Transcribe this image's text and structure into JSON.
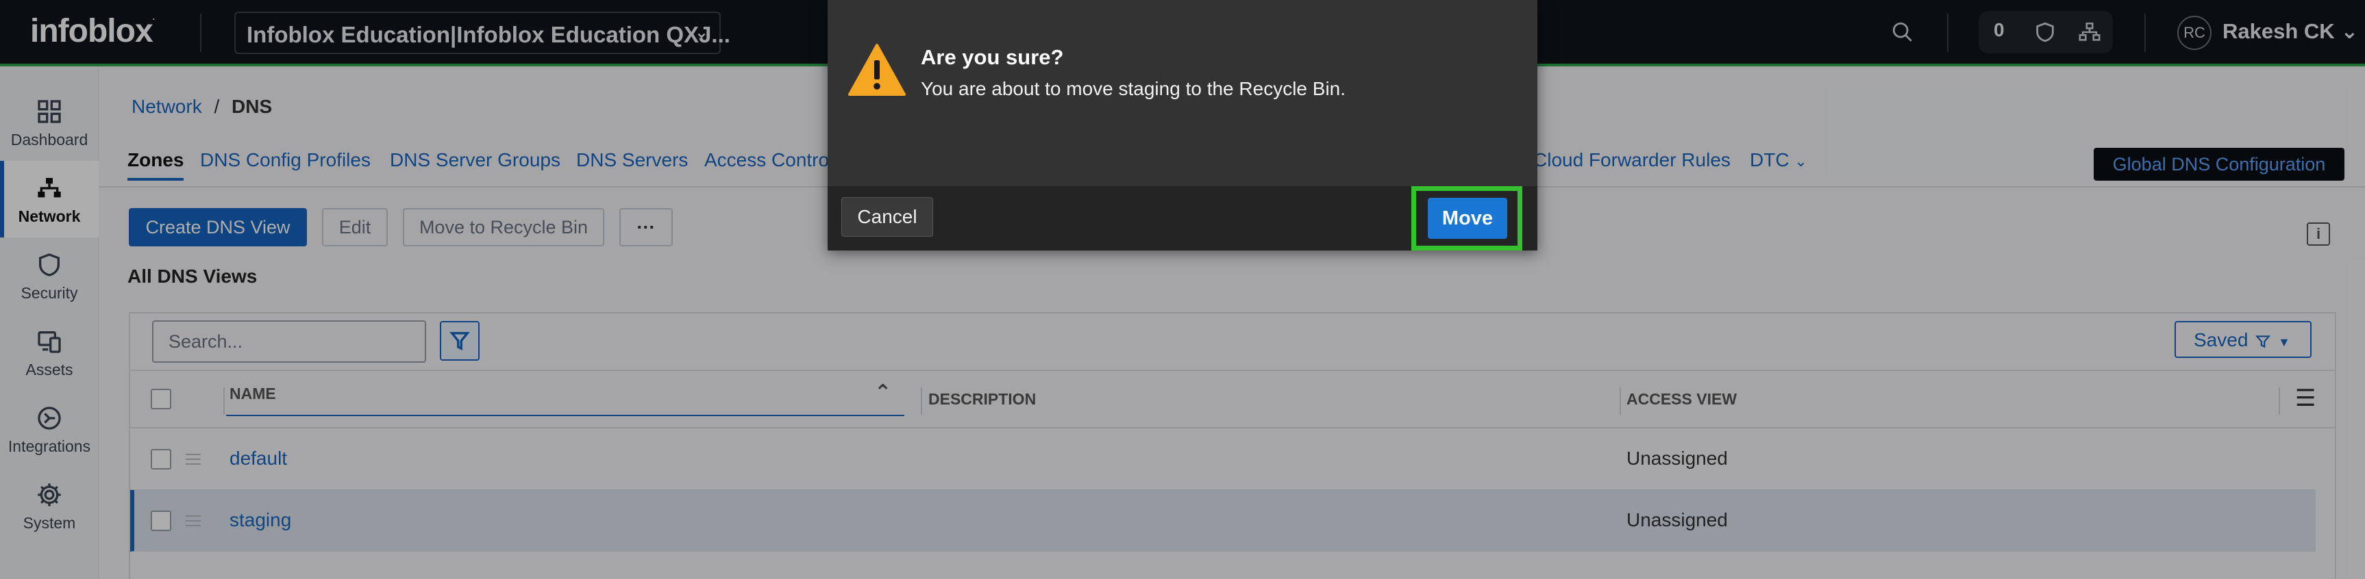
{
  "topbar": {
    "logo": "infoblox",
    "tenant": "Infoblox Education|Infoblox Education QXJ...",
    "notification_count": "0",
    "user_initials": "RC",
    "user_name": "Rakesh CK"
  },
  "sidenav": {
    "items": [
      {
        "label": "Dashboard",
        "icon": "grid-icon"
      },
      {
        "label": "Network",
        "icon": "network-icon",
        "active": true
      },
      {
        "label": "Security",
        "icon": "shield-icon"
      },
      {
        "label": "Assets",
        "icon": "assets-icon"
      },
      {
        "label": "Integrations",
        "icon": "integrations-icon"
      },
      {
        "label": "System",
        "icon": "gear-icon"
      }
    ]
  },
  "breadcrumb": {
    "parent": "Network",
    "separator": "/",
    "current": "DNS"
  },
  "tabs": [
    "Zones",
    "DNS Config Profiles",
    "DNS Server Groups",
    "DNS Servers",
    "Access Contro",
    "Cloud Forwarder Rules",
    "DTC"
  ],
  "global_dns_button": "Global DNS Configuration",
  "toolbar": {
    "create": "Create DNS View",
    "edit": "Edit",
    "recycle": "Move to Recycle Bin",
    "more": "···"
  },
  "section_title": "All DNS Views",
  "search": {
    "placeholder": "Search..."
  },
  "saved_label": "Saved",
  "table": {
    "columns": [
      "NAME",
      "DESCRIPTION",
      "ACCESS VIEW"
    ],
    "rows": [
      {
        "name": "default",
        "description": "",
        "access_view": "Unassigned"
      },
      {
        "name": "staging",
        "description": "",
        "access_view": "Unassigned"
      }
    ]
  },
  "modal": {
    "title": "Are you sure?",
    "message": "You are about to move staging to the Recycle Bin.",
    "cancel": "Cancel",
    "confirm": "Move"
  },
  "colors": {
    "accent": "#1565c0",
    "topbar": "#10151c",
    "warning": "#f5a623",
    "highlight": "#35c02d"
  }
}
